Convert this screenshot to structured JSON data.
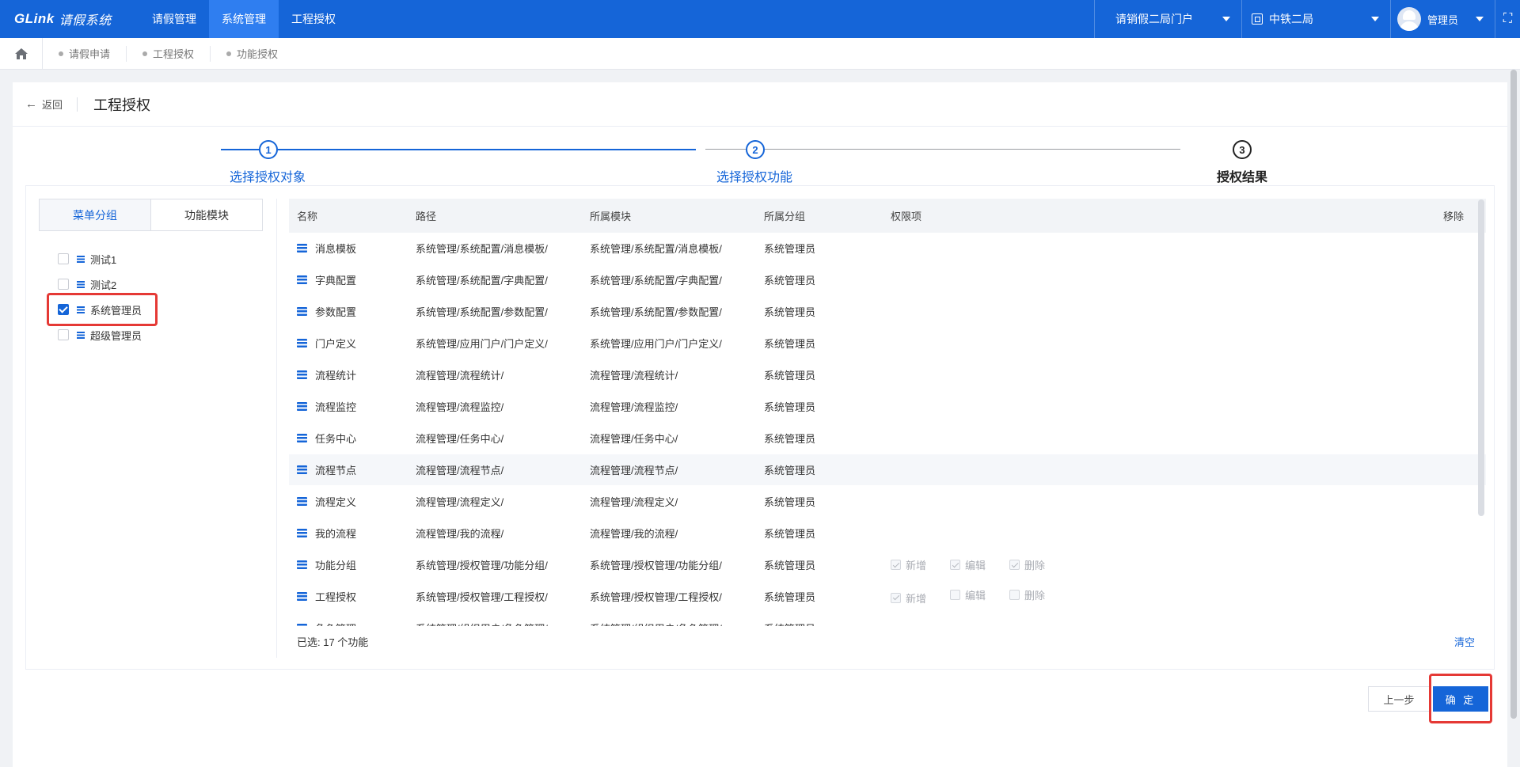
{
  "app": {
    "logo": "GLink",
    "title": "请假系统"
  },
  "topnav": [
    {
      "label": "请假管理",
      "active": false
    },
    {
      "label": "系统管理",
      "active": true
    },
    {
      "label": "工程授权",
      "active": false
    }
  ],
  "portal_select": "请销假二局门户",
  "org_select": "中铁二局",
  "user_name": "管理员",
  "breadcrumb_tabs": [
    "请假申请",
    "工程授权",
    "功能授权"
  ],
  "page": {
    "back_label": "返回",
    "title": "工程授权"
  },
  "steps": [
    {
      "num": "1",
      "label": "选择授权对象",
      "state": "done"
    },
    {
      "num": "2",
      "label": "选择授权功能",
      "state": "done"
    },
    {
      "num": "3",
      "label": "授权结果",
      "state": "current"
    }
  ],
  "left_tabs": [
    {
      "label": "菜单分组",
      "active": true
    },
    {
      "label": "功能模块",
      "active": false
    }
  ],
  "groups": [
    {
      "label": "测试1",
      "checked": false
    },
    {
      "label": "测试2",
      "checked": false
    },
    {
      "label": "系统管理员",
      "checked": true
    },
    {
      "label": "超级管理员",
      "checked": false
    }
  ],
  "table": {
    "headers": {
      "name": "名称",
      "path": "路径",
      "module": "所属模块",
      "group": "所属分组",
      "perm": "权限项",
      "remove": "移除"
    },
    "perm_labels": {
      "add": "新增",
      "edit": "编辑",
      "delete": "删除"
    },
    "rows": [
      {
        "name": "消息模板",
        "path": "系统管理/系统配置/消息模板/",
        "module": "系统管理/系统配置/消息模板/",
        "group": "系统管理员"
      },
      {
        "name": "字典配置",
        "path": "系统管理/系统配置/字典配置/",
        "module": "系统管理/系统配置/字典配置/",
        "group": "系统管理员"
      },
      {
        "name": "参数配置",
        "path": "系统管理/系统配置/参数配置/",
        "module": "系统管理/系统配置/参数配置/",
        "group": "系统管理员"
      },
      {
        "name": "门户定义",
        "path": "系统管理/应用门户/门户定义/",
        "module": "系统管理/应用门户/门户定义/",
        "group": "系统管理员"
      },
      {
        "name": "流程统计",
        "path": "流程管理/流程统计/",
        "module": "流程管理/流程统计/",
        "group": "系统管理员"
      },
      {
        "name": "流程监控",
        "path": "流程管理/流程监控/",
        "module": "流程管理/流程监控/",
        "group": "系统管理员"
      },
      {
        "name": "任务中心",
        "path": "流程管理/任务中心/",
        "module": "流程管理/任务中心/",
        "group": "系统管理员"
      },
      {
        "name": "流程节点",
        "path": "流程管理/流程节点/",
        "module": "流程管理/流程节点/",
        "group": "系统管理员"
      },
      {
        "name": "流程定义",
        "path": "流程管理/流程定义/",
        "module": "流程管理/流程定义/",
        "group": "系统管理员"
      },
      {
        "name": "我的流程",
        "path": "流程管理/我的流程/",
        "module": "流程管理/我的流程/",
        "group": "系统管理员"
      },
      {
        "name": "功能分组",
        "path": "系统管理/授权管理/功能分组/",
        "module": "系统管理/授权管理/功能分组/",
        "group": "系统管理员",
        "perms": {
          "add": true,
          "edit": true,
          "delete": true
        }
      },
      {
        "name": "工程授权",
        "path": "系统管理/授权管理/工程授权/",
        "module": "系统管理/授权管理/工程授权/",
        "group": "系统管理员",
        "perms": {
          "add": true,
          "edit": false,
          "delete": false
        }
      },
      {
        "name": "角色管理",
        "path": "系统管理/组织用户/角色管理/",
        "module": "系统管理/组织用户/角色管理/",
        "group": "系统管理员"
      }
    ]
  },
  "selected_summary": "已选: 17 个功能",
  "clear_label": "清空",
  "buttons": {
    "prev": "上一步",
    "confirm": "确 定"
  },
  "colors": {
    "primary": "#1565d8",
    "highlight": "#e53935"
  }
}
